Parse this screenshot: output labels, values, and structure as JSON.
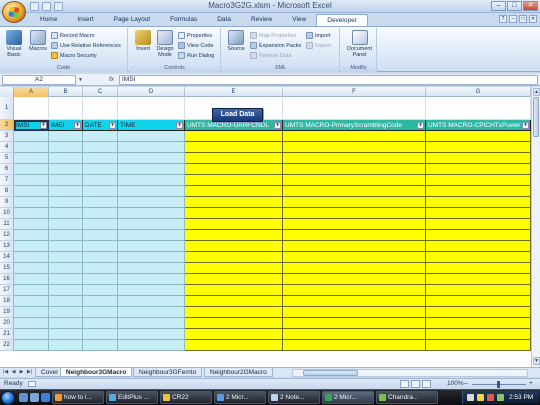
{
  "window": {
    "title": "Macro3G2G.xlsm - Microsoft Excel",
    "minimize": "–",
    "maximize": "□",
    "close": "✕"
  },
  "ribbon_tabs": [
    "Home",
    "Insert",
    "Page Layout",
    "Formulas",
    "Data",
    "Review",
    "View",
    "Developer"
  ],
  "active_tab": "Developer",
  "ribbon": {
    "code": {
      "label": "Code",
      "visual_basic": "Visual Basic",
      "macros": "Macros",
      "record_macro": "Record Macro",
      "relative_refs": "Use Relative References",
      "macro_security": "Macro Security"
    },
    "controls": {
      "label": "Controls",
      "insert": "Insert",
      "design_mode": "Design Mode",
      "properties": "Properties",
      "view_code": "View Code",
      "run_dialog": "Run Dialog"
    },
    "xml": {
      "label": "XML",
      "source": "Source",
      "map_properties": "Map Properties",
      "expansion_packs": "Expansion Packs",
      "refresh_data": "Refresh Data",
      "import": "Import",
      "export": "Export"
    },
    "modify": {
      "label": "Modify",
      "document_panel": "Document Panel"
    }
  },
  "formula_bar": {
    "name_box": "A2",
    "fx": "fx",
    "value": "IMSI"
  },
  "columns": [
    "A",
    "B",
    "C",
    "D",
    "E",
    "F",
    "G"
  ],
  "row_numbers": [
    "1",
    "2",
    "3",
    "4",
    "5",
    "6",
    "7",
    "8",
    "9",
    "10",
    "11",
    "12",
    "13",
    "14",
    "15",
    "16",
    "17",
    "18",
    "19",
    "20",
    "21",
    "22"
  ],
  "load_button": "Load Data",
  "headers": [
    "IMSI",
    "IMEI",
    "DATE",
    "TIME",
    "UMTS MACRO-UARFCNDL",
    "UMTS MACRO-PrimaryScramblingCode",
    "UMTS MACRO-CPICHTxPower"
  ],
  "sheet_tabs": [
    "Cover",
    "Neighbour3GMacro",
    "Neighbour3GFemto",
    "Neighbour2GMacro"
  ],
  "active_sheet": "Neighbour3GMacro",
  "status": {
    "text": "Ready",
    "zoom": "100%",
    "minus": "–",
    "plus": "+"
  },
  "taskbar": {
    "tasks": [
      "how to l...",
      "EditPlus ...",
      "CR22",
      "2 Micr...",
      "2 Note...",
      "2 Micr...",
      "Chandra..."
    ],
    "active_task": "2 Micr...",
    "clock": "2:53 PM"
  },
  "colors": {
    "cyan": "#c7eef7",
    "header_cyan": "#10d4ec",
    "yellow": "#ffff00",
    "header_green": "#2fb7a6",
    "button_blue": "#173878"
  }
}
